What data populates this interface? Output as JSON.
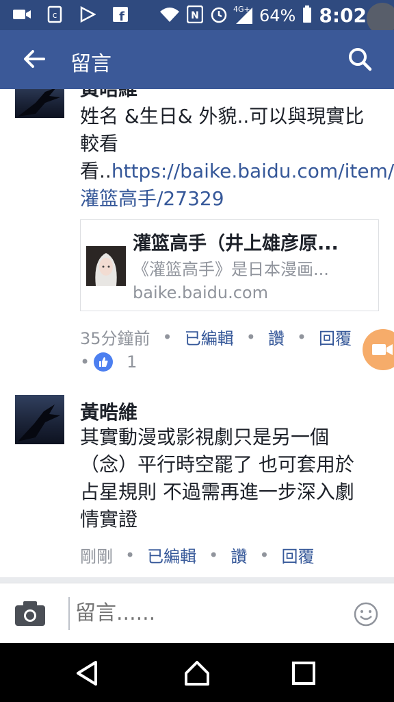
{
  "status_bar": {
    "network": "4G+",
    "battery": "64%",
    "time": "8:02"
  },
  "app_bar": {
    "title": "留言"
  },
  "comment1": {
    "author": "黃晧維",
    "text_plain": "姓名 &生日& 外貌..可以與現實比較看看..",
    "link": "https://baike.baidu.com/item/灌篮高手/27329",
    "preview": {
      "title": "灌篮高手（井上雄彦原...",
      "description": "《灌篮高手》是日本漫画...",
      "domain": "baike.baidu.com"
    },
    "time": "35分鐘前",
    "edited": "已編輯",
    "like": "讚",
    "reply": "回覆",
    "like_count": "1"
  },
  "comment2": {
    "author": "黃晧維",
    "text": "其實動漫或影視劇只是另一個（念）平行時空罷了 也可套用於占星規則 不過需再進一步深入劇情實證",
    "time": "剛剛",
    "edited": "已編輯",
    "like": "讚",
    "reply": "回覆"
  },
  "composer": {
    "placeholder": "留言......"
  },
  "colors": {
    "status_bar": "#2f4a7f",
    "app_bar": "#3b5998",
    "link": "#365899",
    "meta": "#90949c",
    "like_badge": "#4c7ff0"
  }
}
